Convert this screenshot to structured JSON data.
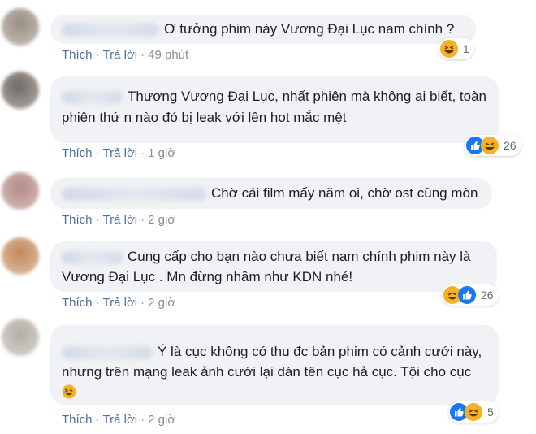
{
  "labels": {
    "like": "Thích",
    "reply": "Trả lời",
    "sep": "·"
  },
  "colors": {
    "bubble": "#f0f2f5",
    "action": "#4b6fa3",
    "like": "#1877f2",
    "haha": "#f7b125"
  },
  "comments": [
    {
      "text": "Ơ tưởng phim này Vương Đại Lục nam chính ?",
      "time": "49 phút",
      "reactions": [
        "haha"
      ],
      "count": "1"
    },
    {
      "text": "Thương Vương Đại Lục, nhất phiên mà không ai biết, toàn phiên thứ n nào đó bị leak với lên hot mắc mệt",
      "time": "1 giờ",
      "reactions": [
        "like",
        "haha"
      ],
      "count": "26"
    },
    {
      "text": "Chờ cái film mấy năm oi, chờ ost cũng mòn",
      "time": "2 giờ",
      "reactions": [],
      "count": ""
    },
    {
      "text": "Cung cấp cho bạn nào chưa biết nam chính phim này là Vương Đại Lục . Mn đừng nhầm như KDN nhé!",
      "time": "2 giờ",
      "reactions": [
        "haha",
        "like"
      ],
      "count": "26"
    },
    {
      "text": "Ý là cục không có thu đc bản phim có cảnh cưới này, nhưng trên mạng leak ảnh cưới lại dán tên cục hả cục. Tội cho cục",
      "time": "2 giờ",
      "reactions": [
        "like",
        "haha"
      ],
      "count": "5"
    }
  ]
}
